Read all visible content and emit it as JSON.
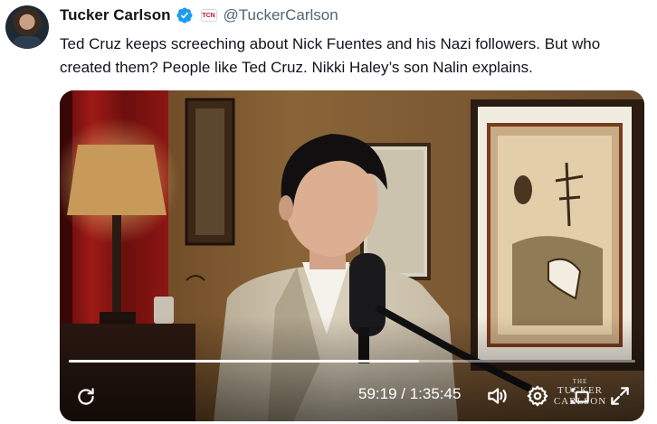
{
  "post": {
    "author_name": "Tucker Carlson",
    "handle": "@TuckerCarlson",
    "affiliate_badge": "TCN",
    "text": "Ted Cruz keeps screeching about Nick Fuentes and his Nazi followers. But who created them? People like Ted Cruz. Nikki Haley’s son Nalin explains."
  },
  "video": {
    "current_time": "59:19",
    "separator": " / ",
    "duration": "1:35:45",
    "progress_fraction": 0.619,
    "watermark_small": "THE",
    "watermark_main": "TUCKER CARLSON"
  },
  "icons": {
    "verified": "verified-badge-icon",
    "replay": "replay-icon",
    "volume": "volume-icon",
    "settings": "settings-gear-icon",
    "captions": "captions-icon",
    "fullscreen": "fullscreen-icon"
  },
  "colors": {
    "verified_blue": "#1d9bf0",
    "handle_gray": "#536471",
    "text": "#0f1419"
  }
}
